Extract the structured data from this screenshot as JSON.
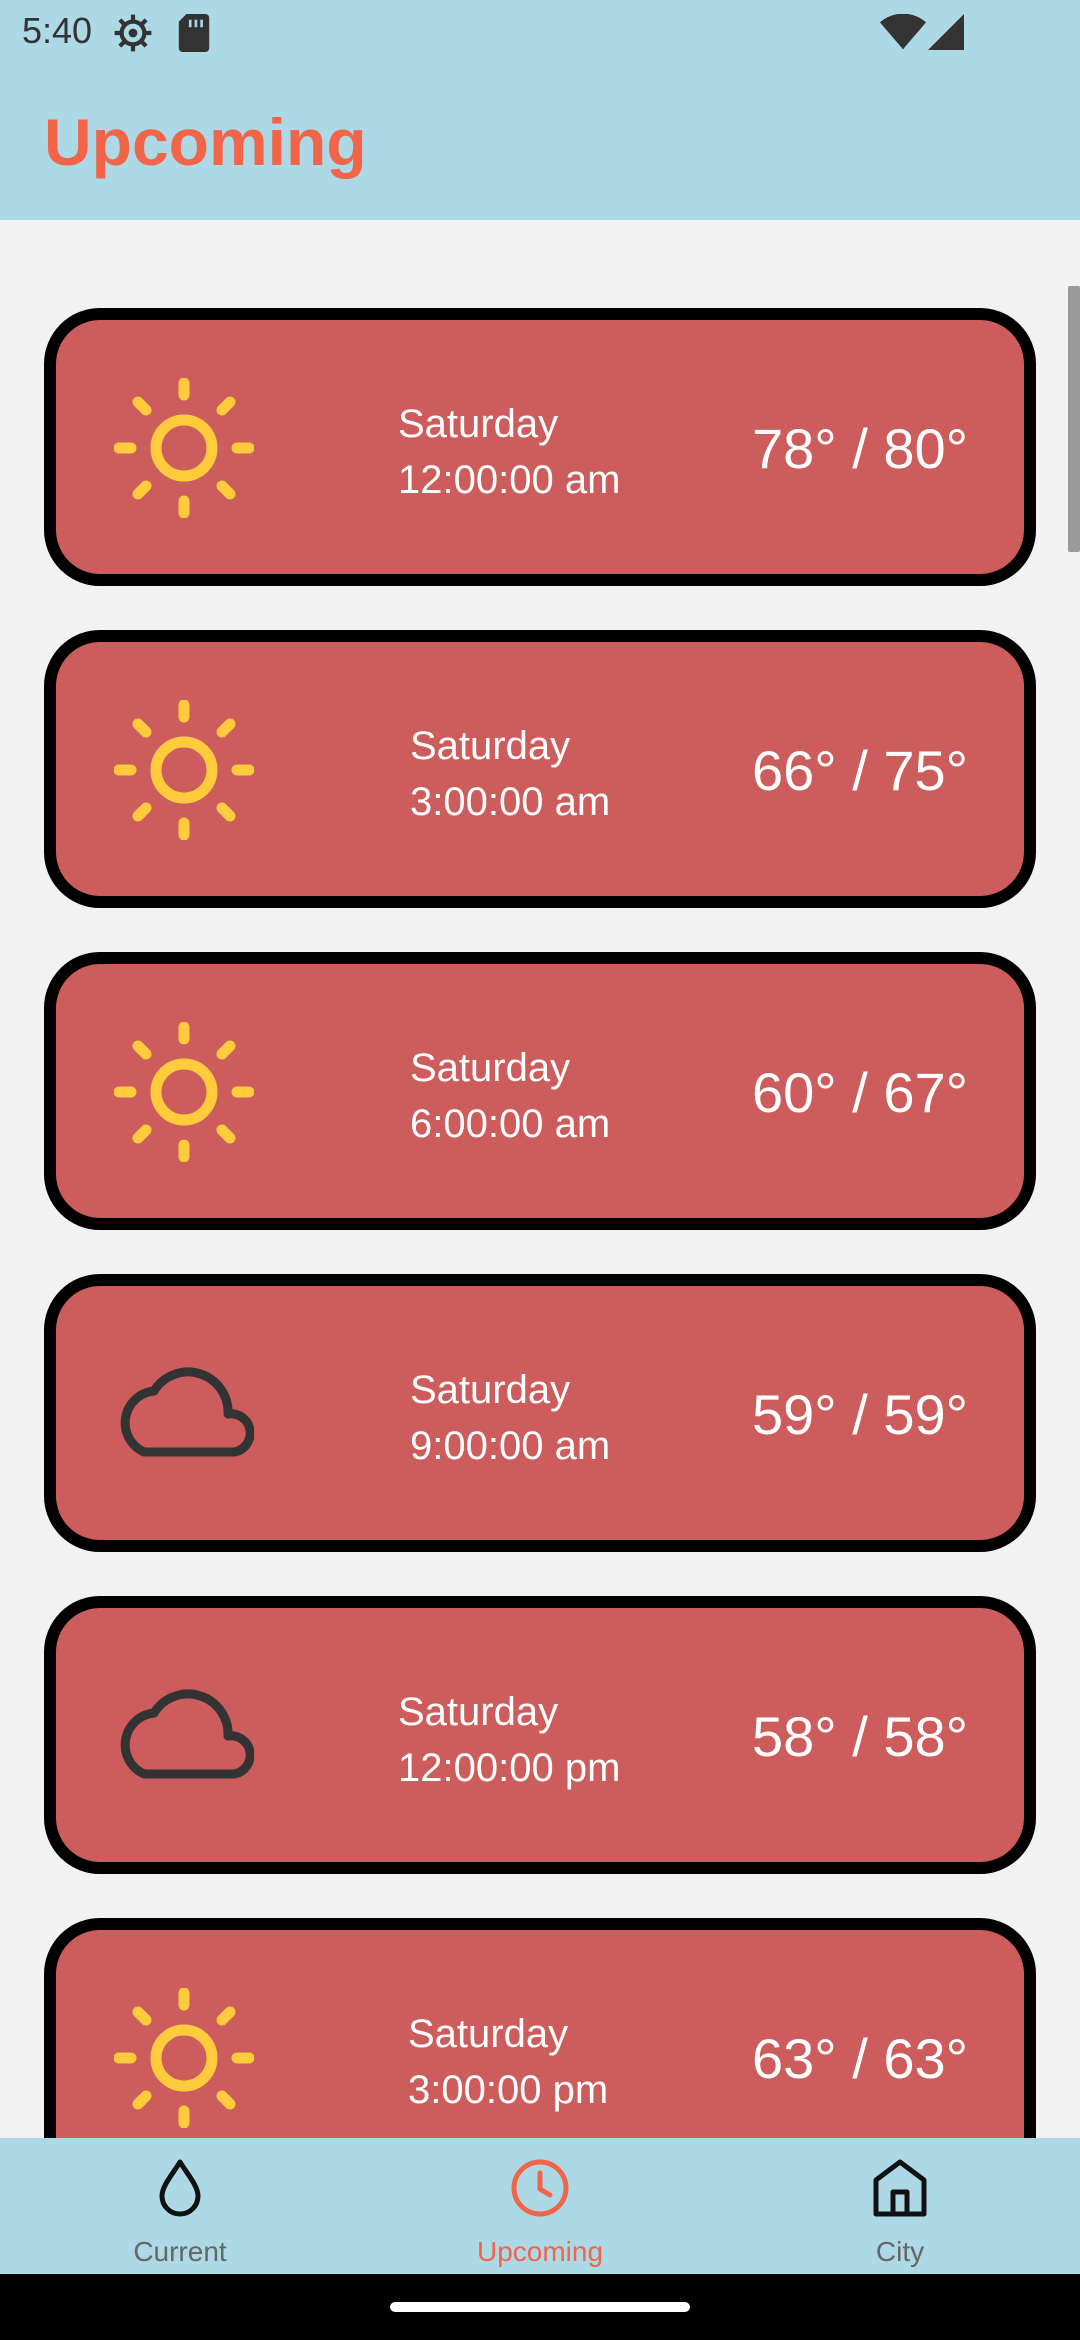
{
  "status_bar": {
    "time": "5:40",
    "icons": [
      "gear-icon",
      "sd-card-icon",
      "wifi-icon",
      "cell-signal-icon"
    ]
  },
  "header": {
    "title": "Upcoming"
  },
  "colors": {
    "header_bg": "#add8e6",
    "accent": "#f26549",
    "card_bg": "#cd5c5c",
    "card_border": "#000000",
    "sun": "#fecb3d",
    "cloud": "#333333"
  },
  "forecast": [
    {
      "icon": "sun-icon",
      "day": "Saturday",
      "time": "12:00:00 am",
      "temps": "78° / 80°"
    },
    {
      "icon": "sun-icon",
      "day": "Saturday",
      "time": "3:00:00 am",
      "temps": "66° / 75°"
    },
    {
      "icon": "sun-icon",
      "day": "Saturday",
      "time": "6:00:00 am",
      "temps": "60° / 67°"
    },
    {
      "icon": "cloud-icon",
      "day": "Saturday",
      "time": "9:00:00 am",
      "temps": "59° / 59°"
    },
    {
      "icon": "cloud-icon",
      "day": "Saturday",
      "time": "12:00:00 pm",
      "temps": "58° / 58°"
    },
    {
      "icon": "sun-icon",
      "day": "Saturday",
      "time": "3:00:00 pm",
      "temps": "63° / 63°"
    }
  ],
  "bottom_nav": {
    "items": [
      {
        "label": "Current",
        "icon": "drop-icon",
        "active": false
      },
      {
        "label": "Upcoming",
        "icon": "clock-icon",
        "active": true
      },
      {
        "label": "City",
        "icon": "home-icon",
        "active": false
      }
    ]
  }
}
